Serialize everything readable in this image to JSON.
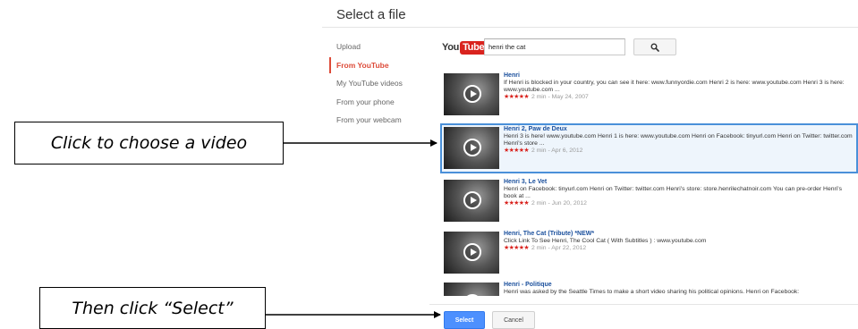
{
  "dialog": {
    "title": "Select a file"
  },
  "nav": {
    "items": [
      {
        "label": "Upload",
        "active": false
      },
      {
        "label": "From YouTube",
        "active": true
      },
      {
        "label": "My YouTube videos",
        "active": false
      },
      {
        "label": "From your phone",
        "active": false
      },
      {
        "label": "From your webcam",
        "active": false
      }
    ]
  },
  "youtube": {
    "logo_you": "You",
    "logo_tube": "Tube"
  },
  "search": {
    "value": "henri the cat",
    "button_icon": "search-icon"
  },
  "results": [
    {
      "title": "Henri",
      "description": "If Henri is blocked in your country, you can see it here: www.funnyordie.com Henri 2 is here: www.youtube.com Henri 3 is here: www.youtube.com ...",
      "stars": "★★★★★",
      "meta": "2 min - May 24, 2007",
      "selected": false
    },
    {
      "title": "Henri 2, Paw de Deux",
      "description": "Henri 3 is here! www.youtube.com Henri 1 is here: www.youtube.com Henri on Facebook: tinyurl.com Henri on Twitter: twitter.com Henri's store ...",
      "stars": "★★★★★",
      "meta": "2 min - Apr 6, 2012",
      "selected": true
    },
    {
      "title": "Henri 3, Le Vet",
      "description": "Henri on Facebook: tinyurl.com Henri on Twitter: twitter.com Henri's store: store.henrilechatnoir.com You can pre-order Henri's book at ...",
      "stars": "★★★★★",
      "meta": "2 min - Jun 20, 2012",
      "selected": false
    },
    {
      "title": "Henri, The Cat (Tribute) *NEW*",
      "description": "Click Link To See Henri, The Cool Cat ( With Subtitles ) : www.youtube.com",
      "stars": "★★★★★",
      "meta": "2 min - Apr 22, 2012",
      "selected": false
    },
    {
      "title": "Henri - Politique",
      "description": "Henri was asked by the Seattle Times to make a short video sharing his political opinions. Henri on Facebook:",
      "stars": "",
      "meta": "",
      "selected": false
    }
  ],
  "footer": {
    "select_label": "Select",
    "cancel_label": "Cancel"
  },
  "annotations": {
    "choose_video": "Click to choose a video",
    "then_select": "Then click “Select”"
  },
  "colors": {
    "accent_red": "#dd4b39",
    "select_blue": "#4d90fe",
    "selected_border": "#4a90d9",
    "star_red": "#d9231e"
  }
}
